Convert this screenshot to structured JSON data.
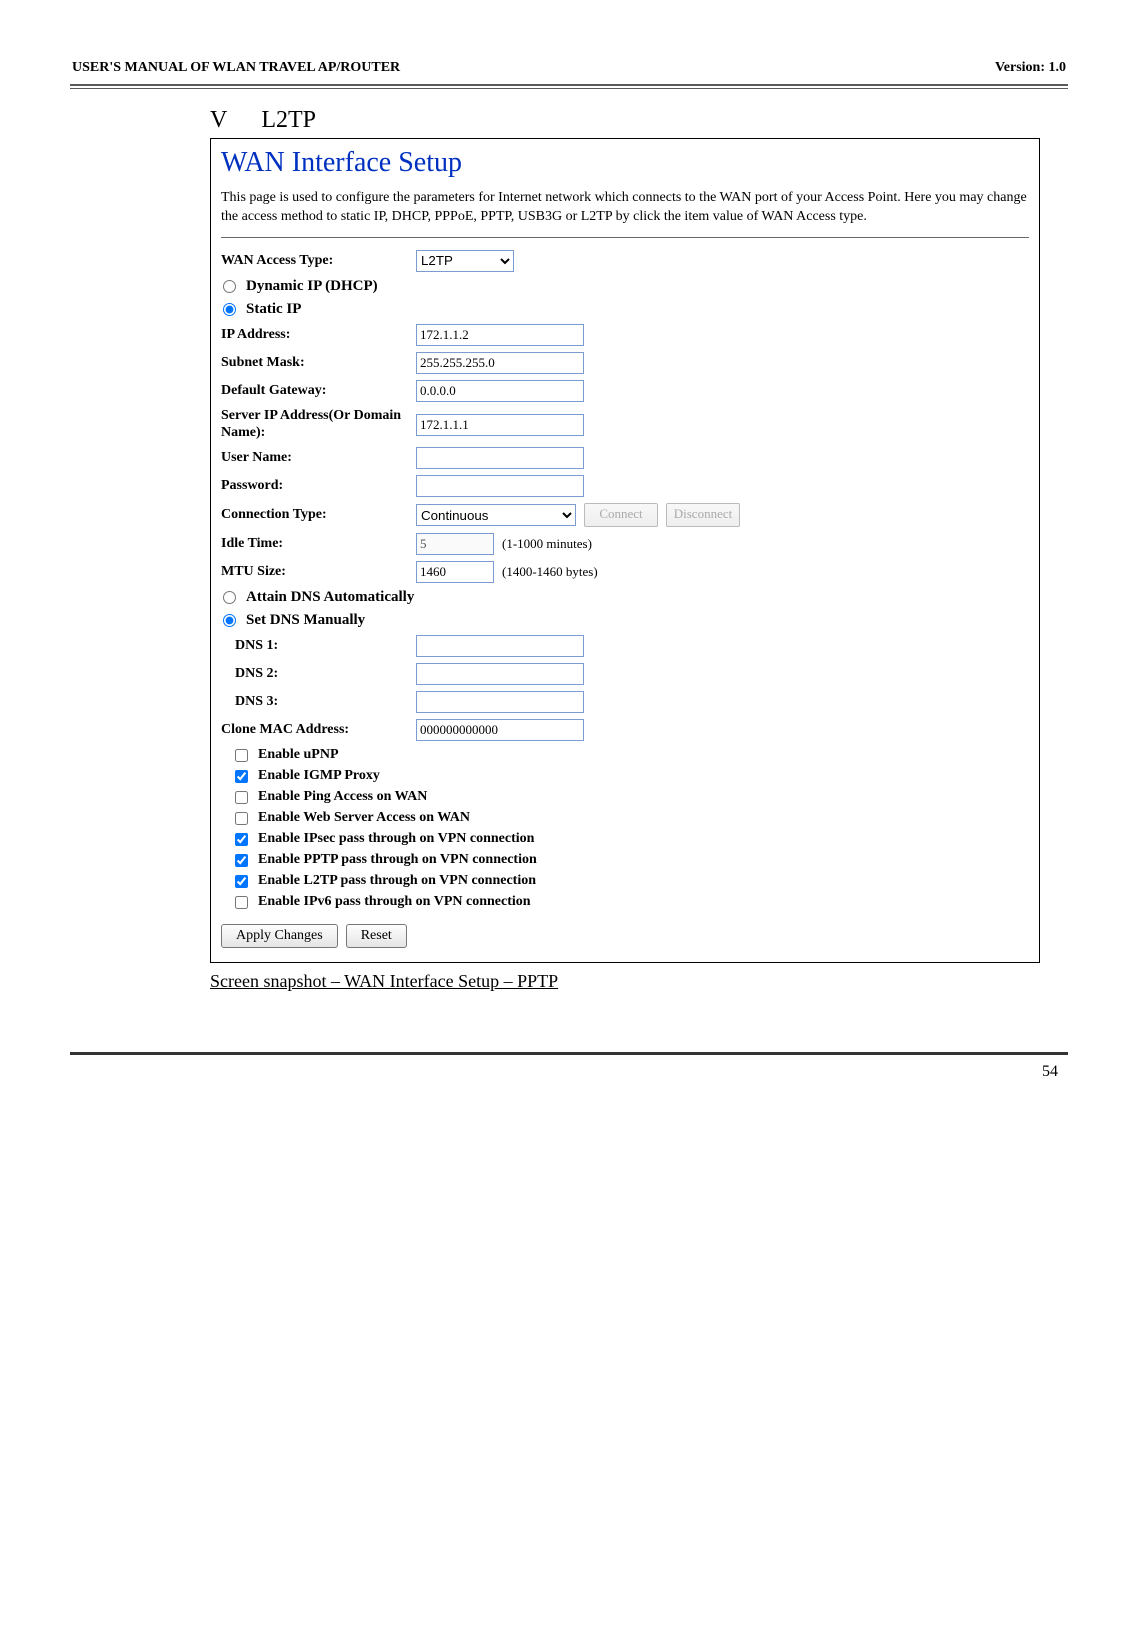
{
  "doc": {
    "header_left": "USER'S MANUAL OF WLAN TRAVEL AP/ROUTER",
    "header_right": "Version: 1.0",
    "section_roman": "V",
    "section_name": "L2TP",
    "caption": "Screen snapshot – WAN Interface Setup – PPTP",
    "page": "54"
  },
  "panel": {
    "title": "WAN Interface Setup",
    "intro": "This page is used to configure the parameters for Internet network which connects to the WAN port of your Access Point. Here you may change the access method to static IP, DHCP, PPPoE, PPTP, USB3G or L2TP by click the item value of WAN Access type.",
    "wan_access": {
      "label": "WAN Access Type:",
      "value": "L2TP"
    },
    "ipmode": {
      "dhcp": "Dynamic IP (DHCP)",
      "static": "Static IP"
    },
    "ip": {
      "label": "IP Address:",
      "value": "172.1.1.2"
    },
    "mask": {
      "label": "Subnet Mask:",
      "value": "255.255.255.0"
    },
    "gw": {
      "label": "Default Gateway:",
      "value": "0.0.0.0"
    },
    "server": {
      "label": "Server IP Address(Or Domain Name):",
      "value": "172.1.1.1"
    },
    "user": {
      "label": "User Name:",
      "value": ""
    },
    "pass": {
      "label": "Password:",
      "value": ""
    },
    "conn": {
      "label": "Connection Type:",
      "value": "Continuous",
      "connect": "Connect",
      "disconnect": "Disconnect"
    },
    "idle": {
      "label": "Idle Time:",
      "value": "5",
      "hint": "(1-1000 minutes)"
    },
    "mtu": {
      "label": "MTU Size:",
      "value": "1460",
      "hint": "(1400-1460 bytes)"
    },
    "dnsmode": {
      "auto": "Attain DNS Automatically",
      "manual": "Set DNS Manually"
    },
    "dns1": {
      "label": "DNS 1:",
      "value": ""
    },
    "dns2": {
      "label": "DNS 2:",
      "value": ""
    },
    "dns3": {
      "label": "DNS 3:",
      "value": ""
    },
    "clone": {
      "label": "Clone MAC Address:",
      "value": "000000000000"
    },
    "checks": {
      "upnp": "Enable uPNP",
      "igmp": "Enable IGMP Proxy",
      "ping": "Enable Ping Access on WAN",
      "web": "Enable Web Server Access on WAN",
      "ipsec": "Enable IPsec pass through on VPN connection",
      "pptp": "Enable PPTP pass through on VPN connection",
      "l2tp": "Enable L2TP pass through on VPN connection",
      "ipv6": "Enable IPv6 pass through on VPN connection"
    },
    "buttons": {
      "apply": "Apply Changes",
      "reset": "Reset"
    }
  }
}
